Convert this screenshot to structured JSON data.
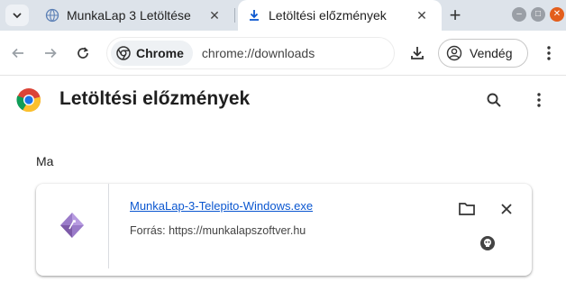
{
  "tabs": [
    {
      "title": "MunkaLap 3 Letöltése",
      "icon": "globe-icon",
      "active": false
    },
    {
      "title": "Letöltési előzmények",
      "icon": "download-icon",
      "active": true
    }
  ],
  "toolbar": {
    "chip_label": "Chrome",
    "url": "chrome://downloads",
    "profile_label": "Vendég"
  },
  "page": {
    "title": "Letöltési előzmények",
    "date_group": "Ma"
  },
  "download": {
    "filename": "MunkaLap-3-Telepito-Windows.exe",
    "source_prefix": "Forrás:",
    "source_url": "https://munkalapszoftver.hu",
    "icon": "executable-file-icon"
  },
  "colors": {
    "accent": "#0b57d0",
    "tabstrip": "#dde3ea",
    "window_close": "#e35e1c"
  }
}
